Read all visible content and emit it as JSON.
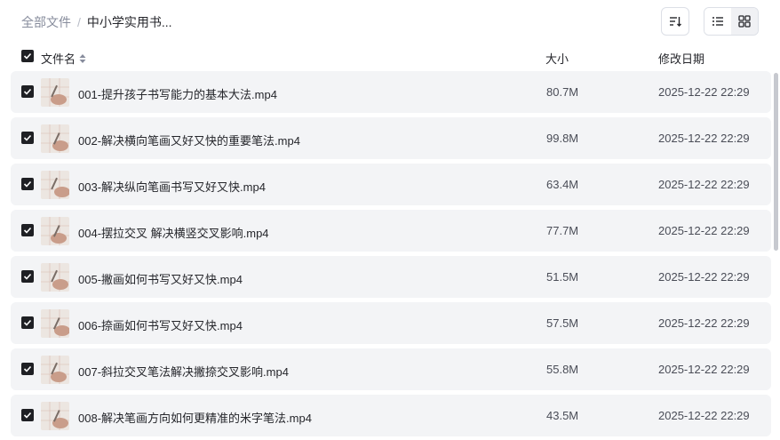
{
  "breadcrumb": {
    "root": "全部文件",
    "separator": "/",
    "current": "中小学实用书..."
  },
  "toolbar": {
    "sort_icon": "sort-icon",
    "list_view_icon": "list-view-icon",
    "grid_view_icon": "grid-view-icon"
  },
  "table": {
    "headers": {
      "name": "文件名",
      "size": "大小",
      "date": "修改日期"
    },
    "rows": [
      {
        "name": "001-提升孩子书写能力的基本大法.mp4",
        "size": "80.7M",
        "date": "2025-12-22 22:29"
      },
      {
        "name": "002-解决横向笔画又好又快的重要笔法.mp4",
        "size": "99.8M",
        "date": "2025-12-22 22:29"
      },
      {
        "name": "003-解决纵向笔画书写又好又快.mp4",
        "size": "63.4M",
        "date": "2025-12-22 22:29"
      },
      {
        "name": "004-摆拉交叉 解决横竖交叉影响.mp4",
        "size": "77.7M",
        "date": "2025-12-22 22:29"
      },
      {
        "name": "005-撇画如何书写又好又快.mp4",
        "size": "51.5M",
        "date": "2025-12-22 22:29"
      },
      {
        "name": "006-捺画如何书写又好又快.mp4",
        "size": "57.5M",
        "date": "2025-12-22 22:29"
      },
      {
        "name": "007-斜拉交叉笔法解决撇捺交叉影响.mp4",
        "size": "55.8M",
        "date": "2025-12-22 22:29"
      },
      {
        "name": "008-解决笔画方向如何更精准的米字笔法.mp4",
        "size": "43.5M",
        "date": "2025-12-22 22:29"
      }
    ]
  },
  "colors": {
    "accent": "#1f2024",
    "row_bg": "#f3f4f6",
    "muted": "#878c9c"
  }
}
